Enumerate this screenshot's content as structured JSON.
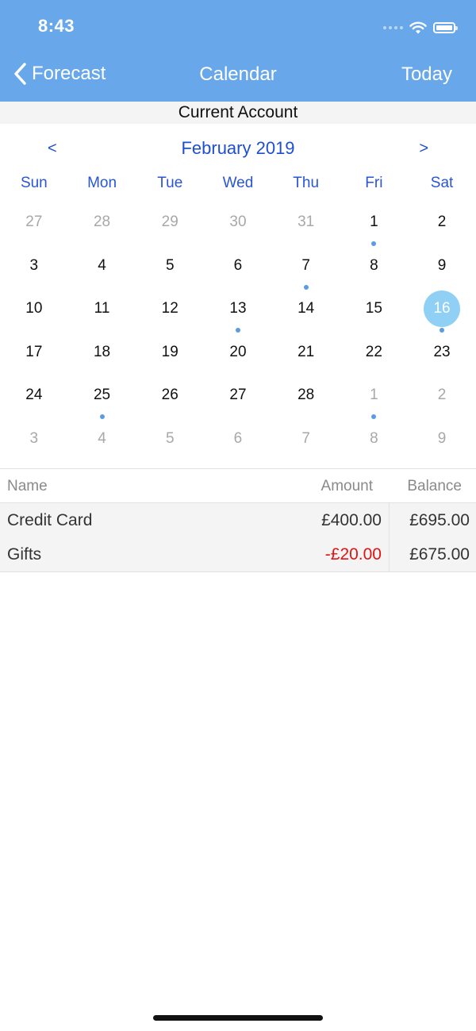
{
  "status": {
    "time": "8:43"
  },
  "nav": {
    "back_label": "Forecast",
    "title": "Calendar",
    "today_label": "Today"
  },
  "account": {
    "name": "Current Account"
  },
  "calendar": {
    "prev": "<",
    "next": ">",
    "month_title": "February 2019",
    "weekdays": [
      "Sun",
      "Mon",
      "Tue",
      "Wed",
      "Thu",
      "Fri",
      "Sat"
    ],
    "weeks": [
      [
        {
          "d": "27",
          "m": true
        },
        {
          "d": "28",
          "m": true
        },
        {
          "d": "29",
          "m": true
        },
        {
          "d": "30",
          "m": true
        },
        {
          "d": "31",
          "m": true
        },
        {
          "d": "1",
          "dot": true
        },
        {
          "d": "2"
        }
      ],
      [
        {
          "d": "3"
        },
        {
          "d": "4"
        },
        {
          "d": "5"
        },
        {
          "d": "6"
        },
        {
          "d": "7",
          "dot": true
        },
        {
          "d": "8"
        },
        {
          "d": "9"
        }
      ],
      [
        {
          "d": "10"
        },
        {
          "d": "11"
        },
        {
          "d": "12"
        },
        {
          "d": "13",
          "dot": true
        },
        {
          "d": "14"
        },
        {
          "d": "15"
        },
        {
          "d": "16",
          "sel": true,
          "dot": true
        }
      ],
      [
        {
          "d": "17"
        },
        {
          "d": "18"
        },
        {
          "d": "19"
        },
        {
          "d": "20"
        },
        {
          "d": "21"
        },
        {
          "d": "22"
        },
        {
          "d": "23"
        }
      ],
      [
        {
          "d": "24"
        },
        {
          "d": "25",
          "dot": true
        },
        {
          "d": "26"
        },
        {
          "d": "27"
        },
        {
          "d": "28"
        },
        {
          "d": "1",
          "m": true,
          "dot": true
        },
        {
          "d": "2",
          "m": true
        }
      ],
      [
        {
          "d": "3",
          "m": true
        },
        {
          "d": "4",
          "m": true
        },
        {
          "d": "5",
          "m": true
        },
        {
          "d": "6",
          "m": true
        },
        {
          "d": "7",
          "m": true
        },
        {
          "d": "8",
          "m": true
        },
        {
          "d": "9",
          "m": true
        }
      ]
    ]
  },
  "table": {
    "headers": {
      "name": "Name",
      "amount": "Amount",
      "balance": "Balance"
    },
    "rows": [
      {
        "name": "Credit Card",
        "amount": "£400.00",
        "balance": "£695.00",
        "negative": false
      },
      {
        "name": "Gifts",
        "amount": "-£20.00",
        "balance": "£675.00",
        "negative": true
      }
    ]
  },
  "colors": {
    "header_blue": "#68a7ea",
    "link_blue": "#1f4fd1",
    "selected_day": "#8fd0f4",
    "event_dot": "#5a9ce3",
    "negative_red": "#e01414"
  }
}
